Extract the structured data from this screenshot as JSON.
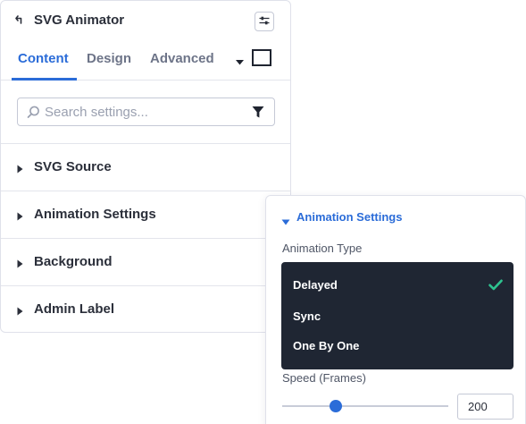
{
  "panel": {
    "title": "SVG Animator",
    "icons": {
      "back": "return-arrow-icon",
      "options": "sliders-icon"
    }
  },
  "tabs": [
    {
      "label": "Content",
      "active": true
    },
    {
      "label": "Design",
      "active": false
    },
    {
      "label": "Advanced",
      "active": false
    }
  ],
  "tab_extras": {
    "caret_icon": "caret-down-icon",
    "square_icon": "square-outline-icon"
  },
  "search": {
    "placeholder": "Search settings...",
    "value": "",
    "icons": {
      "search": "search-icon",
      "filter": "filter-funnel-icon"
    }
  },
  "sections": [
    {
      "label": "SVG Source"
    },
    {
      "label": "Animation Settings"
    },
    {
      "label": "Background"
    },
    {
      "label": "Admin Label"
    }
  ],
  "popover": {
    "title": "Animation Settings",
    "animation_type_label": "Animation Type",
    "options": [
      {
        "label": "Delayed",
        "selected": true
      },
      {
        "label": "Sync",
        "selected": false
      },
      {
        "label": "One By One",
        "selected": false
      }
    ],
    "speed_label": "Speed (Frames)",
    "speed_value": "200",
    "speed_slider_fraction": 0.32
  },
  "colors": {
    "accent": "#2b6cd8",
    "dropdown_bg": "#1f2633",
    "check": "#2ec28f",
    "text": "#2b2f3a"
  }
}
